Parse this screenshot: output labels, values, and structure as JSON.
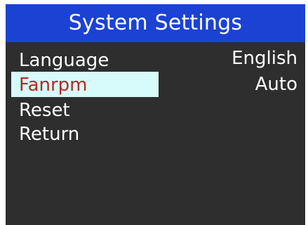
{
  "window": {
    "title": "System Settings"
  },
  "menu": {
    "items": [
      {
        "label": "Language",
        "value": "English"
      },
      {
        "label": "Fanrpm",
        "value": "Auto",
        "selected": true
      },
      {
        "label": "Reset"
      },
      {
        "label": "Return"
      }
    ]
  },
  "colors": {
    "title_bar": "#1b42d2",
    "screen_bg": "#2e2e2e",
    "highlight_bg": "#d7fbfa",
    "selected_text": "#b52a23",
    "text": "#ffffff"
  }
}
